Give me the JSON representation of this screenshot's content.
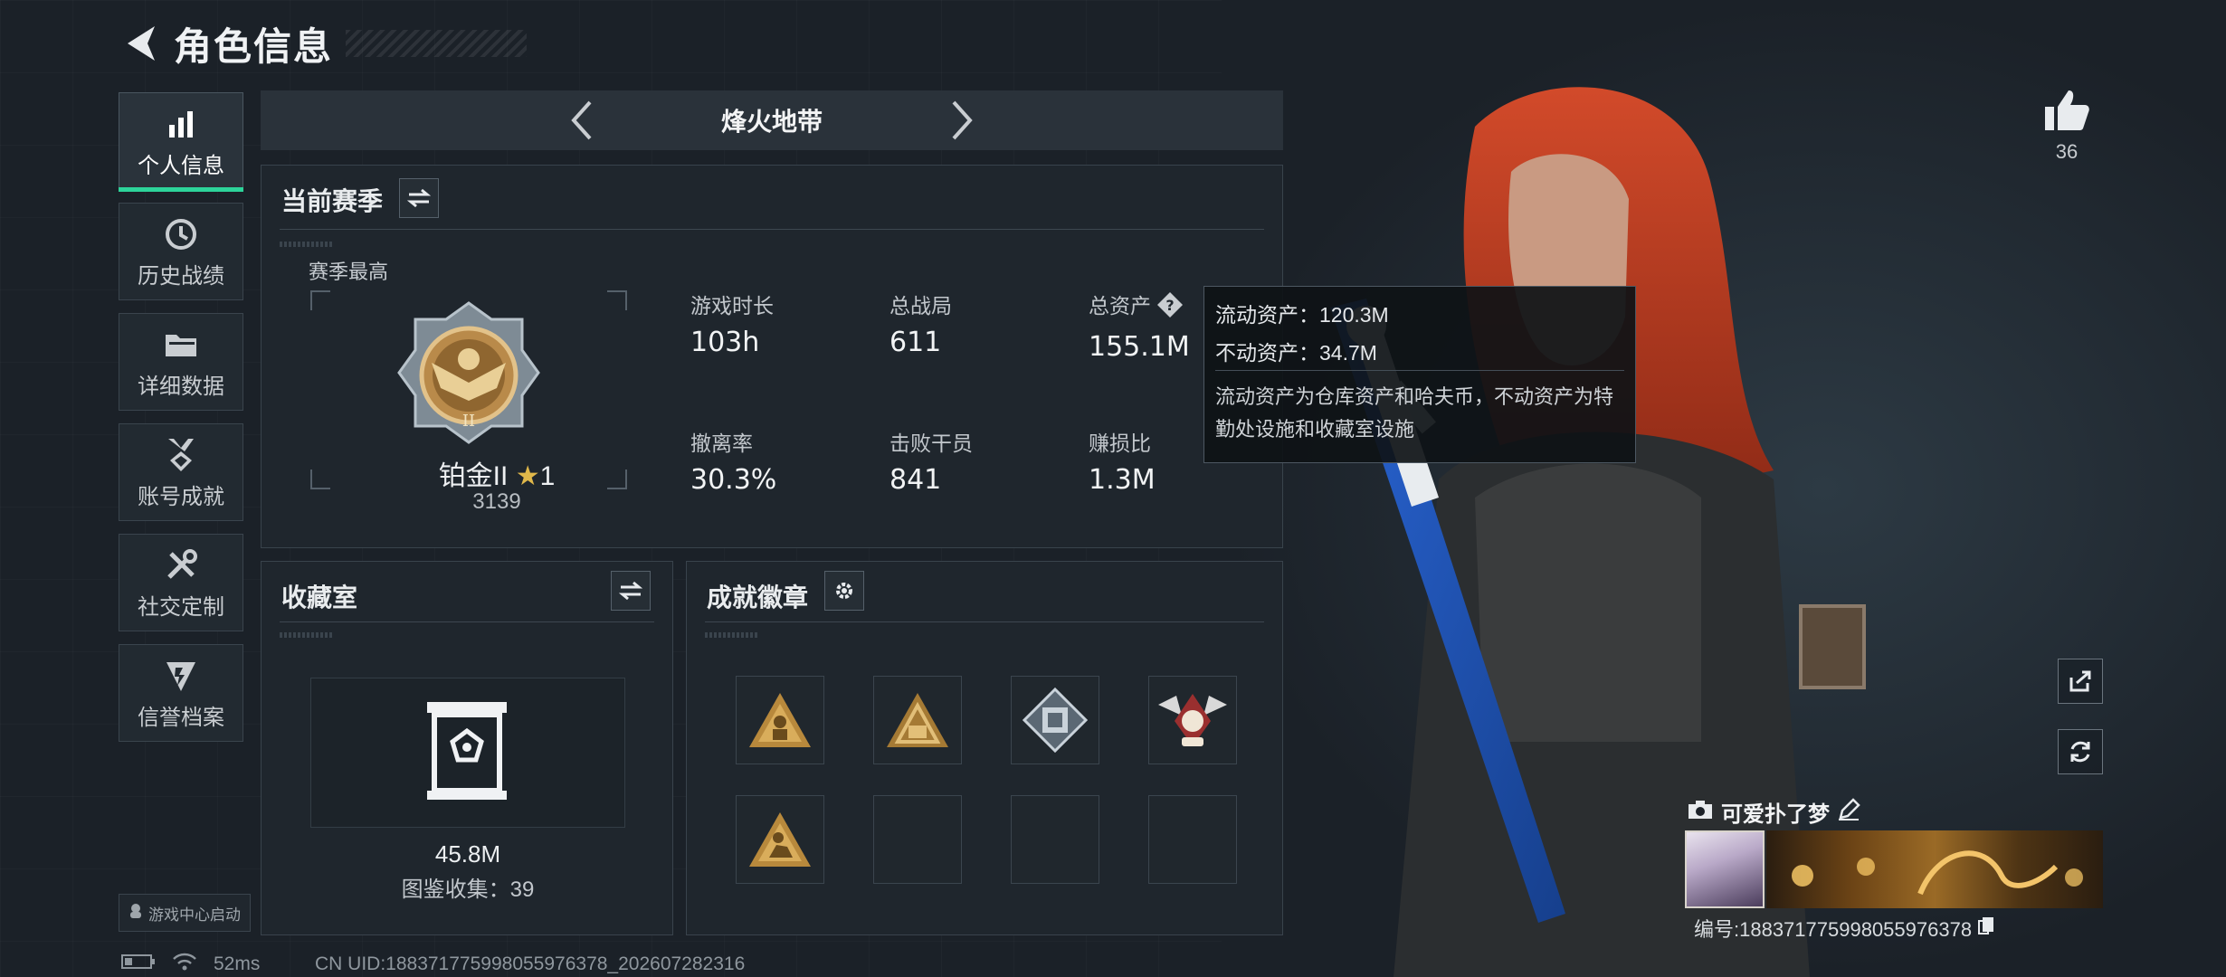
{
  "header": {
    "title": "角色信息"
  },
  "sidebar": {
    "items": [
      {
        "label": "个人信息",
        "icon": "bar-chart-icon",
        "active": true
      },
      {
        "label": "历史战绩",
        "icon": "clock-icon",
        "active": false
      },
      {
        "label": "详细数据",
        "icon": "folder-icon",
        "active": false
      },
      {
        "label": "账号成就",
        "icon": "medal-icon",
        "active": false
      },
      {
        "label": "社交定制",
        "icon": "tools-icon",
        "active": false
      },
      {
        "label": "信誉档案",
        "icon": "shield-icon",
        "active": false
      }
    ],
    "game_center": "游戏中心启动"
  },
  "mode_tab": {
    "title": "烽火地带"
  },
  "season": {
    "title": "当前赛季",
    "best_label": "赛季最高",
    "rank_name": "铂金II",
    "rank_stars": "1",
    "rank_score": "3139",
    "stats": [
      {
        "label": "游戏时长",
        "value": "103h"
      },
      {
        "label": "总战局",
        "value": "611"
      },
      {
        "label": "总资产",
        "value": "155.1M"
      },
      {
        "label": "撤离率",
        "value": "30.3%"
      },
      {
        "label": "击败干员",
        "value": "841"
      },
      {
        "label": "赚损比",
        "value": "1.3M"
      }
    ]
  },
  "tooltip": {
    "liquid": "流动资产：120.3M",
    "fixed": "不动资产：34.7M",
    "desc": "流动资产为仓库资产和哈夫币，不动资产为特勤处设施和收藏室设施"
  },
  "collection": {
    "title": "收藏室",
    "value": "45.8M",
    "sub": "图鉴收集：39"
  },
  "achievements": {
    "title": "成就徽章",
    "badges": [
      "worker-badge",
      "trader-badge",
      "tech-badge",
      "winged-badge",
      "soldier-badge",
      "",
      "",
      ""
    ]
  },
  "likes": {
    "count": "36"
  },
  "player": {
    "name": "可爱扑了梦",
    "id": "编号:1883717759980559763​78"
  },
  "status": {
    "ping": "52ms",
    "uid": "CN UID:18837177599805597​6378_202607282316"
  },
  "colors": {
    "accent": "#2dd49a",
    "panel": "#1f262d",
    "hair": "#c9452a"
  }
}
